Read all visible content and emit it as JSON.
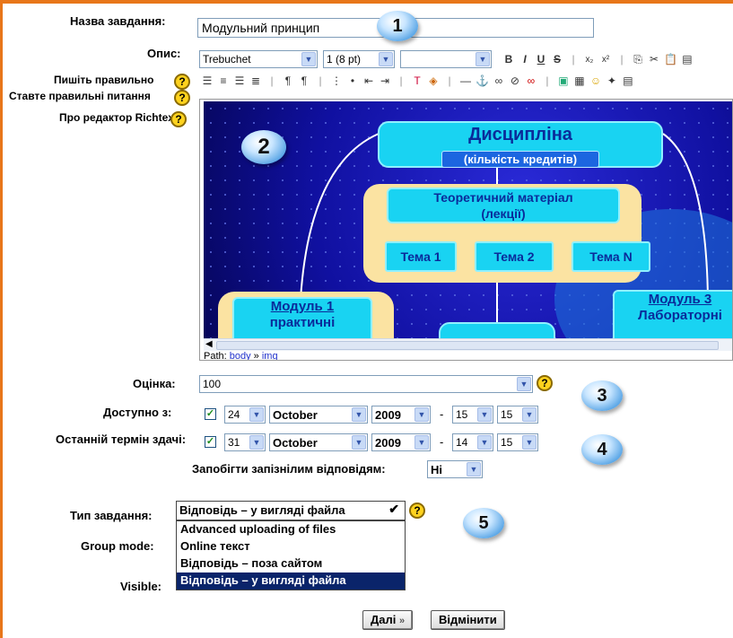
{
  "form": {
    "name_label": "Назва завдання:",
    "name_value": "Модульний принцип",
    "desc_label": "Опис:",
    "help_links": [
      "Пишіть правильно",
      "Ставте правильні питання",
      "Про редактор Richtext"
    ]
  },
  "toolbar": {
    "font_family": "Trebuchet",
    "font_size": "1 (8 pt)",
    "style_value": "",
    "bold": "B",
    "italic": "I",
    "underline": "U",
    "strike": "S"
  },
  "diagram": {
    "title": "Дисципліна",
    "subtitle": "(кількість кредитів)",
    "theory": "Теоретичний матеріал",
    "theory_sub": "(лекції)",
    "topics": [
      "Тема 1",
      "Тема 2",
      "Тема N"
    ],
    "module1": "Модуль 1",
    "module1_sub": "практичні",
    "module3": "Модуль 3",
    "module3_sub": "Лабораторні"
  },
  "editor": {
    "path_label": "Path:",
    "path_body": "body",
    "path_sep": "»",
    "path_img": "img"
  },
  "grade": {
    "label": "Оцінка:",
    "value": "100"
  },
  "available": {
    "label": "Доступно з:",
    "day": "24",
    "month": "October",
    "year": "2009",
    "dash": "-",
    "hour": "15",
    "minute": "15"
  },
  "due": {
    "label": "Останній термін здачі:",
    "day": "31",
    "month": "October",
    "year": "2009",
    "dash": "-",
    "hour": "14",
    "minute": "15"
  },
  "prevent_late": {
    "label": "Запобігти запізнілим відповідям:",
    "value": "Ні"
  },
  "assignment_type": {
    "label": "Тип завдання:",
    "value": "Відповідь – у вигляді файла",
    "options": [
      "Advanced uploading of files",
      "Online текст",
      "Відповідь – поза сайтом",
      "Відповідь – у вигляді файла"
    ]
  },
  "group_mode": {
    "label": "Group mode:"
  },
  "visible": {
    "label": "Visible:"
  },
  "badges": [
    "1",
    "2",
    "3",
    "4",
    "5"
  ],
  "buttons": {
    "next": "Далі",
    "next_arrow": "»",
    "cancel": "Відмінити"
  }
}
